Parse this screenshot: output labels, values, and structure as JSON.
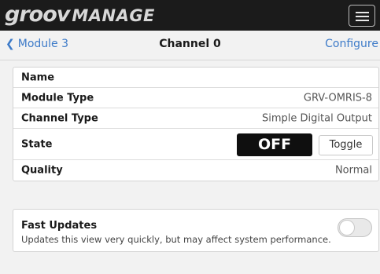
{
  "header": {
    "logo_part1": "groov",
    "logo_part2": "MANAGE",
    "menu_icon": "hamburger-menu-icon"
  },
  "nav": {
    "back_label": "Module 3",
    "title": "Channel 0",
    "configure_label": "Configure"
  },
  "details": {
    "name_label": "Name",
    "name_value": "",
    "module_type_label": "Module Type",
    "module_type_value": "GRV-OMRIS-8",
    "channel_type_label": "Channel Type",
    "channel_type_value": "Simple Digital Output",
    "state_label": "State",
    "state_value": "OFF",
    "toggle_label": "Toggle",
    "quality_label": "Quality",
    "quality_value": "Normal"
  },
  "fast_updates": {
    "title": "Fast Updates",
    "description": "Updates this view very quickly, but may affect system performance.",
    "enabled": false
  },
  "colors": {
    "topbar": "#1b1b1b",
    "link": "#3c7ac8",
    "background": "#f2f2f2"
  }
}
